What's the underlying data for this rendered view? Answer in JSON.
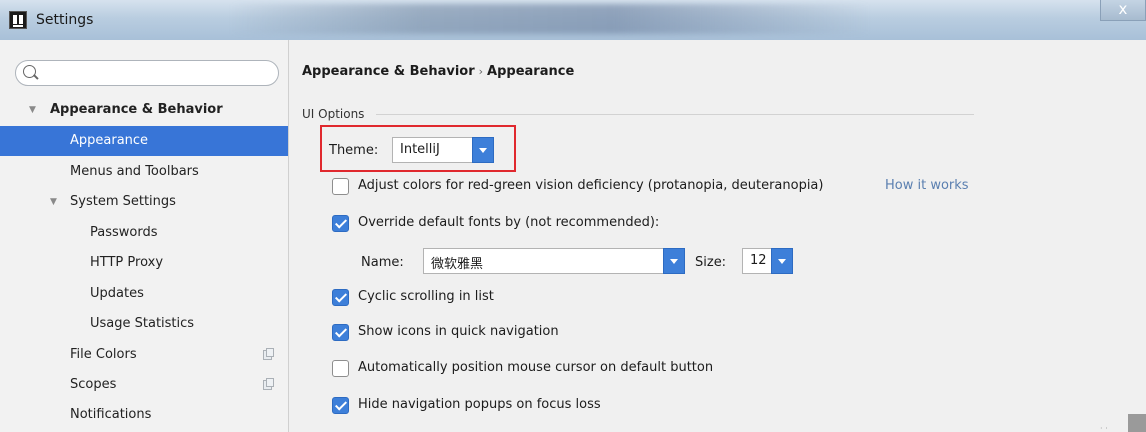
{
  "window": {
    "title": "Settings",
    "close": "x"
  },
  "search": {
    "value": "",
    "placeholder": ""
  },
  "sidebar": {
    "items": [
      {
        "label": "Appearance & Behavior"
      },
      {
        "label": "Appearance"
      },
      {
        "label": "Menus and Toolbars"
      },
      {
        "label": "System Settings"
      },
      {
        "label": "Passwords"
      },
      {
        "label": "HTTP Proxy"
      },
      {
        "label": "Updates"
      },
      {
        "label": "Usage Statistics"
      },
      {
        "label": "File Colors"
      },
      {
        "label": "Scopes"
      },
      {
        "label": "Notifications"
      }
    ]
  },
  "breadcrumb": {
    "parent": "Appearance & Behavior",
    "separator": "›",
    "current": "Appearance"
  },
  "ui_options": {
    "group_title": "UI Options",
    "theme_label": "Theme:",
    "theme_value": "IntelliJ",
    "adjust_colors": {
      "label": "Adjust colors for red-green vision deficiency (protanopia, deuteranopia)",
      "checked": false
    },
    "how_it_works": "How it works",
    "override_fonts": {
      "label": "Override default fonts by (not recommended):",
      "checked": true
    },
    "font_name_label": "Name:",
    "font_name_value": "微软雅黑",
    "font_size_label": "Size:",
    "font_size_value": "12",
    "cyclic_scrolling": {
      "label": "Cyclic scrolling in list",
      "checked": true
    },
    "show_icons": {
      "label": "Show icons in quick navigation",
      "checked": true
    },
    "auto_position": {
      "label": "Automatically position mouse cursor on default button",
      "checked": false
    },
    "hide_popups": {
      "label": "Hide navigation popups on focus loss",
      "checked": true
    }
  },
  "colors": {
    "selection": "#3875d7",
    "accent": "#3d7fd9",
    "highlight_border": "#e0282e",
    "link": "#5a7fb0"
  }
}
